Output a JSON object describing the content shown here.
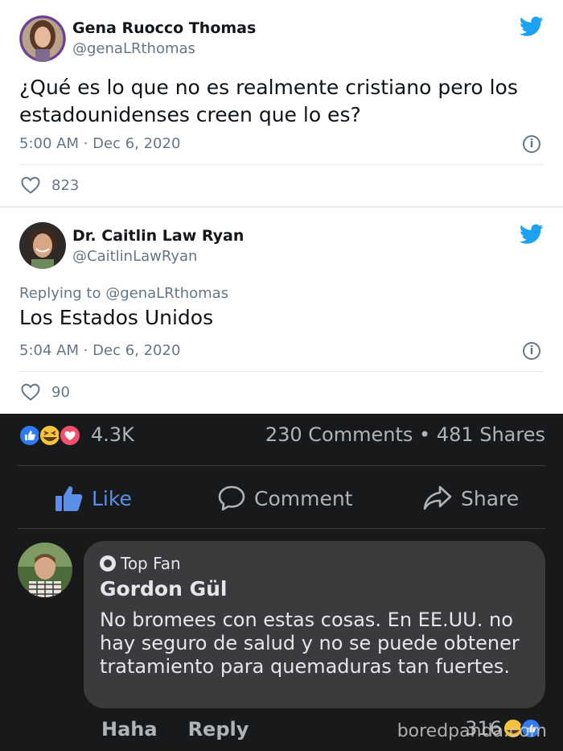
{
  "tweet1": {
    "name": "Gena Ruocco Thomas",
    "handle": "@genaLRthomas",
    "text": "¿Qué es lo que no es realmente cristiano pero los estadounidenses creen que lo es?",
    "timestamp": "5:00 AM · Dec 6, 2020",
    "likes": "823"
  },
  "tweet2": {
    "name": "Dr. Caitlin Law Ryan",
    "handle": "@CaitlinLawRyan",
    "replying_to": "Replying to @genaLRthomas",
    "text": "Los Estados Unidos",
    "timestamp": "5:04 AM · Dec 6, 2020",
    "likes": "90"
  },
  "facebook": {
    "reaction_count": "4.3K",
    "comments_shares": "230 Comments • 481 Shares",
    "actions": {
      "like": "Like",
      "comment": "Comment",
      "share": "Share"
    },
    "comment": {
      "badge": "Top Fan",
      "author": "Gordon Gül",
      "text": "No bromees con estas cosas. En EE.UU. no hay seguro de salud y no se puede obtener tratamiento para quemaduras tan fuertes.",
      "haha": "Haha",
      "reply": "Reply",
      "reaction_count": "316"
    },
    "watermark": "boredpanda.com"
  },
  "colors": {
    "twitter_blue": "#1da1f2",
    "fb_blue": "#5b8fe8",
    "fb_bg": "#18191a",
    "bubble": "#3a3b3c"
  },
  "icons": [
    "twitter-bird-icon",
    "heart-outline-icon",
    "info-icon",
    "like-thumb-icon",
    "comment-bubble-icon",
    "share-arrow-icon",
    "haha-icon",
    "love-icon",
    "wow-icon"
  ]
}
